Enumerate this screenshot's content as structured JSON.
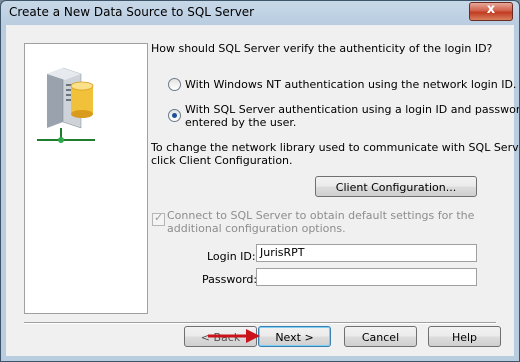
{
  "window": {
    "title": "Create a New Data Source to SQL Server",
    "close_glyph": "x"
  },
  "question": "How should SQL Server verify the authenticity of the login ID?",
  "auth_options": [
    {
      "label": "With Windows NT authentication using the network login ID.",
      "selected": false
    },
    {
      "label_line1": "With SQL Server authentication using a login ID and password",
      "label_line2": "entered by the user.",
      "selected": true
    }
  ],
  "network_text": {
    "line1": "To change the network library used to communicate with SQL Server,",
    "line2": "click Client Configuration."
  },
  "client_config_label": "Client Configuration...",
  "connect_option": {
    "line1": "Connect to SQL Server to obtain default settings for the",
    "line2": "additional configuration options.",
    "checked": true,
    "enabled": false
  },
  "login": {
    "label": "Login ID:",
    "value": "JurisRPT"
  },
  "password": {
    "label": "Password:",
    "value": ""
  },
  "buttons": {
    "back": "< Back",
    "next": "Next >",
    "cancel": "Cancel",
    "help": "Help"
  },
  "icons": {
    "left": "server-network-icon",
    "pointer": "red-arrow-icon"
  },
  "colors": {
    "accent": "#3c7fb1",
    "arrow": "#c8141a"
  }
}
